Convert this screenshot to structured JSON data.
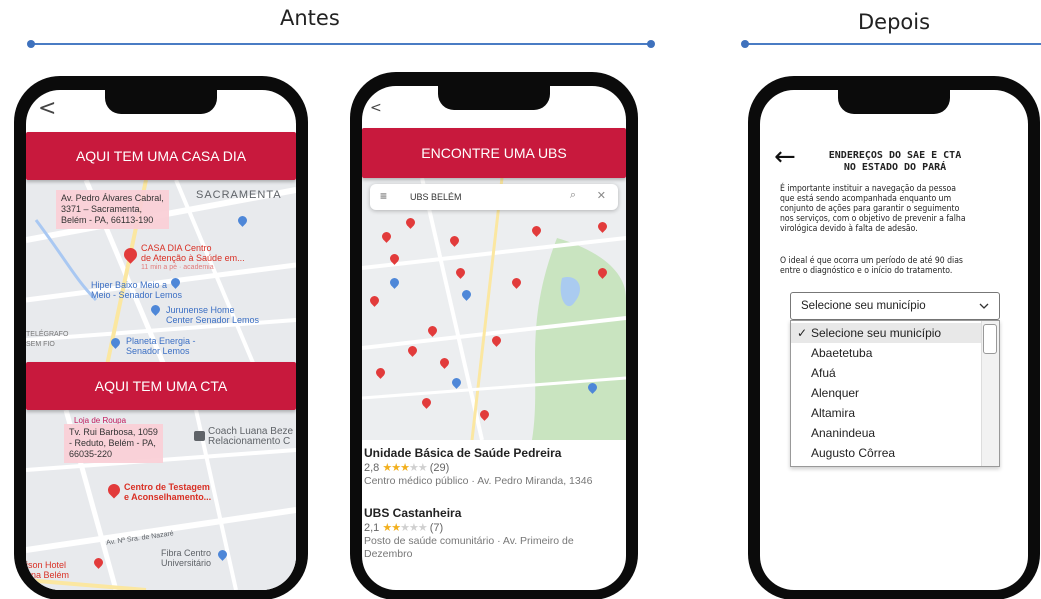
{
  "sections": {
    "before": "Antes",
    "after": "Depois"
  },
  "colors": {
    "accent_red": "#c8193d",
    "timeline_blue": "#4a7cc4"
  },
  "phone1": {
    "back_icon": "<",
    "banner_top": "AQUI TEM UMA CASA DIA",
    "map_top": {
      "address": [
        "Av. Pedro Álvares Cabral,",
        "3371 – Sacramenta,",
        "Belém - PA, 66113-190"
      ],
      "neighborhood": "SACRAMENTA",
      "place_main": [
        "CASA DIA Centro",
        "de Atenção à Saúde em..."
      ],
      "place_main_sub": "11 min a pé · academia",
      "place_2": [
        "Hiper Baixo Meio a",
        "Meio - Senador Lemos"
      ],
      "place_3": [
        "Jurunense Home",
        "Center Senador Lemos"
      ],
      "place_4": [
        "Planeta Energia -",
        "Senador Lemos"
      ],
      "edge_label": [
        "TELÉGRAFO",
        "SEM FIO"
      ]
    },
    "banner_bottom": "AQUI TEM UMA CTA",
    "map_bottom": {
      "shop_label": "Loja de Roupa",
      "address": [
        "Tv. Rui Barbosa, 1059",
        "- Reduto, Belém - PA,",
        "66035-220"
      ],
      "place_1": [
        "Coach Luana Beze",
        "Relacionamento C"
      ],
      "place_main": [
        "Centro de Testagem",
        "e Aconselhamento..."
      ],
      "street": "Av. Nª Sra. de Nazaré",
      "place_3": [
        "Fibra Centro",
        "Universitário"
      ],
      "place_4": [
        "ison Hotel",
        "ana Belém"
      ]
    }
  },
  "phone2": {
    "back_icon": "<",
    "banner": "ENCONTRE UMA UBS",
    "search_value": "UBS BELÉM",
    "results": [
      {
        "title": "Unidade Básica de Saúde Pedreira",
        "rating": "2,8",
        "count": "(29)",
        "stars_full": "★★★",
        "stars_empty": "★★",
        "desc": "Centro médico público · Av. Pedro Miranda, 1346"
      },
      {
        "title": "UBS Castanheira",
        "rating": "2,1",
        "count": "(7)",
        "stars_full": "★★",
        "stars_empty": "★★★",
        "desc": "Posto de saúde comunitário · Av. Primeiro de Dezembro"
      }
    ]
  },
  "phone3": {
    "back_icon": "←",
    "heading": [
      "ENDEREÇOS DO SAE E CTA",
      "NO ESTADO DO PARÁ"
    ],
    "paragraph1": [
      "É importante instituir a navegação da pessoa",
      "que está sendo acompanhada enquanto um",
      "conjunto de ações para garantir o seguimento",
      "nos serviços, com o objetivo de prevenir a falha",
      "virológica devido à falta de adesão."
    ],
    "paragraph2": [
      "O ideal é que ocorra um período de até 90 dias",
      "entre o diagnóstico e o início do tratamento."
    ],
    "select": {
      "value": "Selecione seu município"
    },
    "options": [
      "Selecione seu município",
      "Abaetetuba",
      "Afuá",
      "Alenquer",
      "Altamira",
      "Ananindeua",
      "Augusto Côrrea"
    ]
  }
}
